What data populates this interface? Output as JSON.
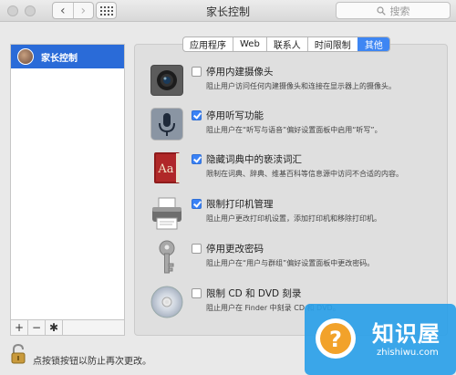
{
  "window": {
    "title": "家长控制",
    "nav_back": "‹",
    "nav_forward": "›",
    "search_placeholder": "搜索"
  },
  "sidebar": {
    "items": [
      {
        "label": "家长控制",
        "selected": true
      }
    ],
    "add_label": "+",
    "remove_label": "−",
    "gear_label": "✱"
  },
  "tabs": [
    {
      "label": "应用程序",
      "active": false
    },
    {
      "label": "Web",
      "active": false
    },
    {
      "label": "联系人",
      "active": false
    },
    {
      "label": "时间限制",
      "active": false
    },
    {
      "label": "其他",
      "active": true
    }
  ],
  "options": [
    {
      "icon": "camera-icon",
      "checked": false,
      "title": "停用内建摄像头",
      "description": "阻止用户访问任何内建摄像头和连接在显示器上的摄像头。"
    },
    {
      "icon": "microphone-icon",
      "checked": true,
      "title": "停用听写功能",
      "description": "阻止用户在“听写与语音”偏好设置面板中启用“听写”。"
    },
    {
      "icon": "dictionary-icon",
      "checked": true,
      "title": "隐藏词典中的亵渎词汇",
      "description": "限制在词典、辞典、维基百科等信息源中访问不合适的内容。"
    },
    {
      "icon": "printer-icon",
      "checked": true,
      "title": "限制打印机管理",
      "description": "阻止用户更改打印机设置，添加打印机和移除打印机。"
    },
    {
      "icon": "key-icon",
      "checked": false,
      "title": "停用更改密码",
      "description": "阻止用户在“用户与群组”偏好设置面板中更改密码。"
    },
    {
      "icon": "disc-icon",
      "checked": false,
      "title": "限制 CD 和 DVD 刻录",
      "description": "阻止用户在 Finder 中刻录 CD 和 DVD。"
    }
  ],
  "footer": {
    "lock_text": "点按锁按钮以防止再次更改。"
  },
  "watermark": {
    "name": "知识屋",
    "url": "zhishiwu.com"
  },
  "colors": {
    "accent": "#3e86f3",
    "sidebar_selected": "#2a6bd8",
    "watermark": "#2aa0e8"
  }
}
